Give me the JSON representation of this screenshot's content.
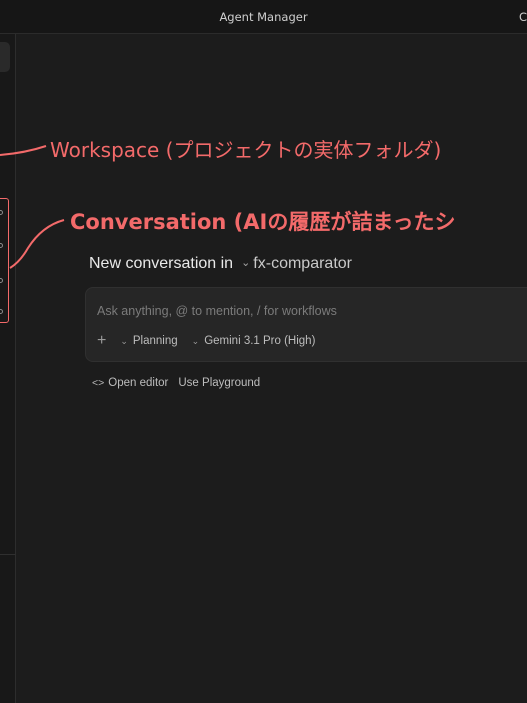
{
  "window": {
    "title": "Agent Manager",
    "right_fragment": "C"
  },
  "main": {
    "new_conversation_label": "New conversation in",
    "workspace_name": "fx-comparator",
    "input": {
      "placeholder": "Ask anything, @ to mention, / for workflows"
    },
    "options": {
      "plus": "+",
      "mode": "Planning",
      "model": "Gemini 3.1 Pro (High)"
    },
    "links": {
      "open_editor": "Open editor",
      "use_playground": "Use Playground"
    }
  },
  "annotations": {
    "workspace": "Workspace (プロジェクトの実体フォルダ)",
    "conversation": "Conversation (AIの履歴が詰まったシ"
  },
  "colors": {
    "annotation": "#f36a6a",
    "background": "#1c1c1c"
  }
}
